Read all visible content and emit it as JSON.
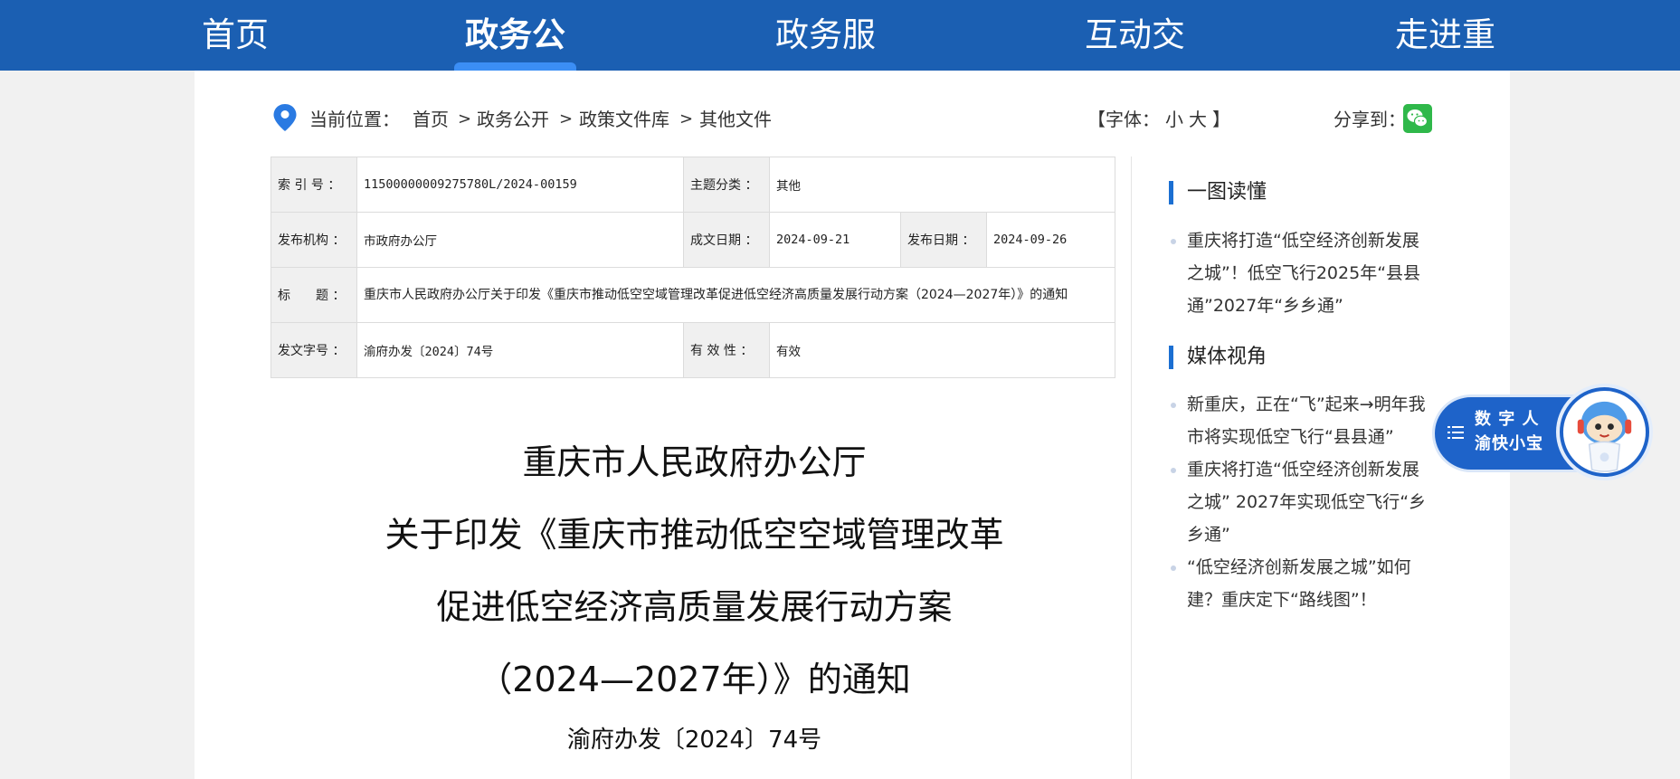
{
  "nav": {
    "items": [
      {
        "label": "首页"
      },
      {
        "label": "政务公开"
      },
      {
        "label": "政务服务"
      },
      {
        "label": "互动交流"
      },
      {
        "label": "走进重庆"
      }
    ],
    "active": "政务公开"
  },
  "breadcrumb": {
    "prefix": "当前位置：",
    "items": [
      "首页",
      "政务公开",
      "政策文件库",
      "其他文件"
    ],
    "separator": ">"
  },
  "font_ctrl": {
    "open": "【字体：",
    "small": "小",
    "large": "大",
    "close": "】"
  },
  "share": {
    "label": "分享到："
  },
  "info_table": {
    "index_label": "索 引 号 ：",
    "index_value": "11500000009275780L/2024-00159",
    "topic_label": "主题分类 ：",
    "topic_value": "其他",
    "publisher_label": "发布机构 ：",
    "publisher_value": "市政府办公厅",
    "written_label": "成文日期 ：",
    "written_value": "2024-09-21",
    "published_label": "发布日期 ：",
    "published_value": "2024-09-26",
    "title_label": "标　　题 ：",
    "title_value": "重庆市人民政府办公厅关于印发《重庆市推动低空空域管理改革促进低空经济高质量发展行动方案（2024—2027年）》的通知",
    "docno_label": "发文字号 ：",
    "docno_value": "渝府办发〔2024〕74号",
    "validity_label": "有 效 性 ：",
    "validity_value": "有效"
  },
  "article": {
    "title_lines": [
      "重庆市人民政府办公厅",
      "关于印发《重庆市推动低空空域管理改革",
      "促进低空经济高质量发展行动方案",
      "（2024—2027年）》的通知"
    ],
    "doc_number": "渝府办发〔2024〕74号"
  },
  "sidebar": {
    "sections": [
      {
        "heading": "一图读懂",
        "items": [
          "重庆将打造“低空经济创新发展之城”！低空飞行2025年“县县通”2027年“乡乡通”"
        ]
      },
      {
        "heading": "媒体视角",
        "items": [
          "新重庆，正在“飞”起来→明年我市将实现低空飞行“县县通”",
          "重庆将打造“低空经济创新发展之城” 2027年实现低空飞行“乡乡通”",
          "“低空经济创新发展之城”如何建？重庆定下“路线图”！"
        ]
      }
    ]
  },
  "digital_human": {
    "line1": "数 字 人",
    "line2": "渝快小宝"
  },
  "colors": {
    "nav_bg": "#1b5fb2",
    "accent": "#1b6fd2",
    "wechat": "#2fb84a"
  }
}
